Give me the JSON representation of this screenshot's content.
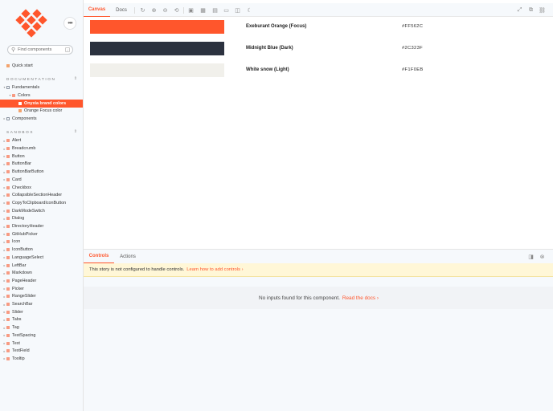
{
  "search": {
    "placeholder": "Find components",
    "shortcut": "/"
  },
  "menu": {
    "label": "•••"
  },
  "sidebar": {
    "quick_start": "Quick start",
    "documentation_title": "DOCUMENTATION",
    "sandbox_title": "SANDBOX",
    "expand_symbol": "⇕",
    "docs_items": [
      {
        "label": "Fundamentals"
      },
      {
        "label": "Colors"
      },
      {
        "label": "Onyxia brand colors"
      },
      {
        "label": "Orange Focus color"
      },
      {
        "label": "Components"
      }
    ],
    "sandbox_items": [
      "Alert",
      "Breadcrumb",
      "Button",
      "ButtonBar",
      "ButtonBarButton",
      "Card",
      "Checkbox",
      "CollapsibleSectionHeader",
      "CopyToClipboardIconButton",
      "DarkModeSwitch",
      "Dialog",
      "DirectoryHeader",
      "GitHubPicker",
      "Icon",
      "IconButton",
      "LanguageSelect",
      "LeftBar",
      "Markdown",
      "PageHeader",
      "Picker",
      "RangeSlider",
      "SearchBar",
      "Slider",
      "Tabs",
      "Tag",
      "TestSpacing",
      "Text",
      "TextField",
      "Tooltip"
    ]
  },
  "toolbar": {
    "tabs": [
      "Canvas",
      "Docs"
    ]
  },
  "colors": [
    {
      "name": "Exeburant Orange (Focus)",
      "hex": "#FF562C",
      "swatch": "#ff562c"
    },
    {
      "name": "Midnight Blue (Dark)",
      "hex": "#2C323F",
      "swatch": "#2c323f"
    },
    {
      "name": "White snow (Light)",
      "hex": "#F1F0EB",
      "swatch": "#f1f0eb"
    }
  ],
  "addons": {
    "tabs": [
      "Controls",
      "Actions"
    ],
    "notice": "This story is not configured to handle controls.",
    "notice_link": "Learn how to add controls ›",
    "no_inputs": "No inputs found for this component.",
    "no_inputs_link": "Read the docs ›"
  }
}
